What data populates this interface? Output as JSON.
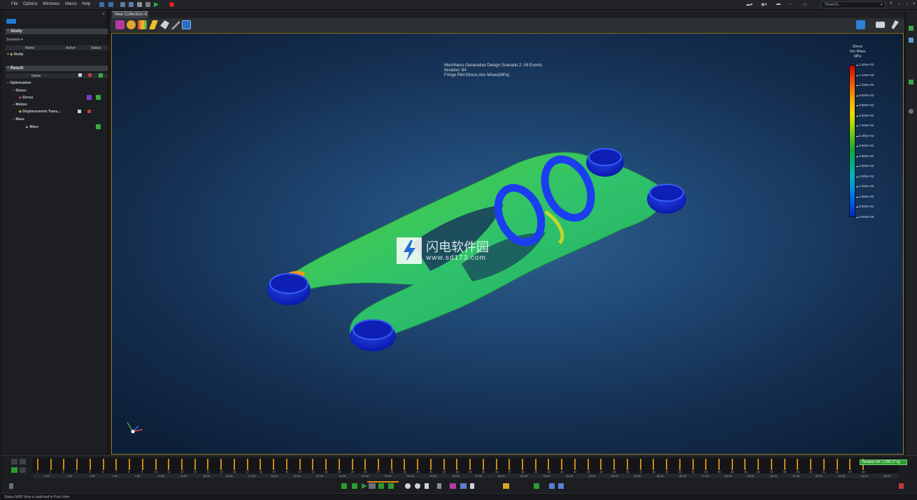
{
  "menu": [
    "File",
    "Options",
    "Windows",
    "Macro",
    "Help"
  ],
  "search": {
    "placeholder": "Search..."
  },
  "left_panel": {
    "study_section": "Study",
    "scenario_dropdown": "Scenario",
    "study_columns": [
      "Name",
      "Active",
      "Status"
    ],
    "study_items": [
      "Study"
    ],
    "result_section": "Result",
    "result_column": "Name",
    "tree": [
      {
        "label": "Optimization",
        "depth": 0
      },
      {
        "label": "Stress",
        "depth": 1
      },
      {
        "label": "Stress",
        "depth": 2
      },
      {
        "label": "Motion",
        "depth": 1
      },
      {
        "label": "Displacements Trans...",
        "depth": 2
      },
      {
        "label": "Mass",
        "depth": 1
      },
      {
        "label": "Mass",
        "depth": 2
      }
    ]
  },
  "tabs": {
    "active": "New Collection: 2"
  },
  "viewport": {
    "info_lines": [
      "MeshNeco Generative Design Scenario 2: All Events",
      "Iteration: 64",
      "Fringe Plot:Stress,Von Mises(MPa)"
    ],
    "legend": {
      "title_lines": [
        "Stress",
        "Von Mises",
        "MPa"
      ],
      "values": [
        "1.200e+03",
        "1.120e+03",
        "1.040e+03",
        "9.600e+02",
        "8.800e+02",
        "8.000e+02",
        "7.200e+02",
        "6.400e+02",
        "5.600e+02",
        "4.800e+02",
        "4.000e+02",
        "3.200e+02",
        "2.400e+02",
        "1.600e+02",
        "8.000e+01",
        "0.000e+00"
      ]
    },
    "watermark_cn": "闪电软件园",
    "watermark_url": "www.sd173.com"
  },
  "timeline": {
    "frames": [
      "1",
      "2",
      "3",
      "4",
      "5",
      "6",
      "7",
      "8",
      "9",
      "10",
      "11",
      "12",
      "13",
      "14",
      "15",
      "16",
      "17",
      "18",
      "19",
      "20",
      "21",
      "22",
      "23",
      "24",
      "25",
      "26",
      "27",
      "28",
      "29",
      "30",
      "31",
      "32",
      "33",
      "34",
      "35",
      "36",
      "37",
      "38",
      "39",
      "40",
      "41",
      "42",
      "43",
      "44",
      "45",
      "46",
      "47",
      "48",
      "49",
      "50",
      "51",
      "52",
      "53",
      "54",
      "55",
      "56",
      "57",
      "58",
      "59",
      "60",
      "61",
      "62",
      "63",
      "64"
    ],
    "labels": [
      "1.00",
      "1.50",
      "1.50",
      "1.50",
      "1.50",
      "13.00",
      "15.00",
      "15.00",
      "16.00",
      "17.00",
      "18.00",
      "19.00",
      "20.00",
      "21.00",
      "22.00",
      "23.00",
      "24.00",
      "25.00",
      "26.00",
      "27.00",
      "28.00",
      "29.00",
      "30.00",
      "31.00",
      "32.00",
      "33.00",
      "34.00",
      "35.00",
      "36.00",
      "37.00",
      "38.00",
      "39.00",
      "40.00",
      "41.00",
      "42.00",
      "43.00",
      "44.00",
      "45.00"
    ],
    "current_badge": "Iteration 64: 1,200.17 kg"
  },
  "status": {
    "message": "Status   MSP View is switched to Post View"
  },
  "colors": {
    "accent": "#1f78d1",
    "frame_border": "#9a7a27",
    "timeline_tick": "#c98c16",
    "badge": "#2e9c2e"
  }
}
